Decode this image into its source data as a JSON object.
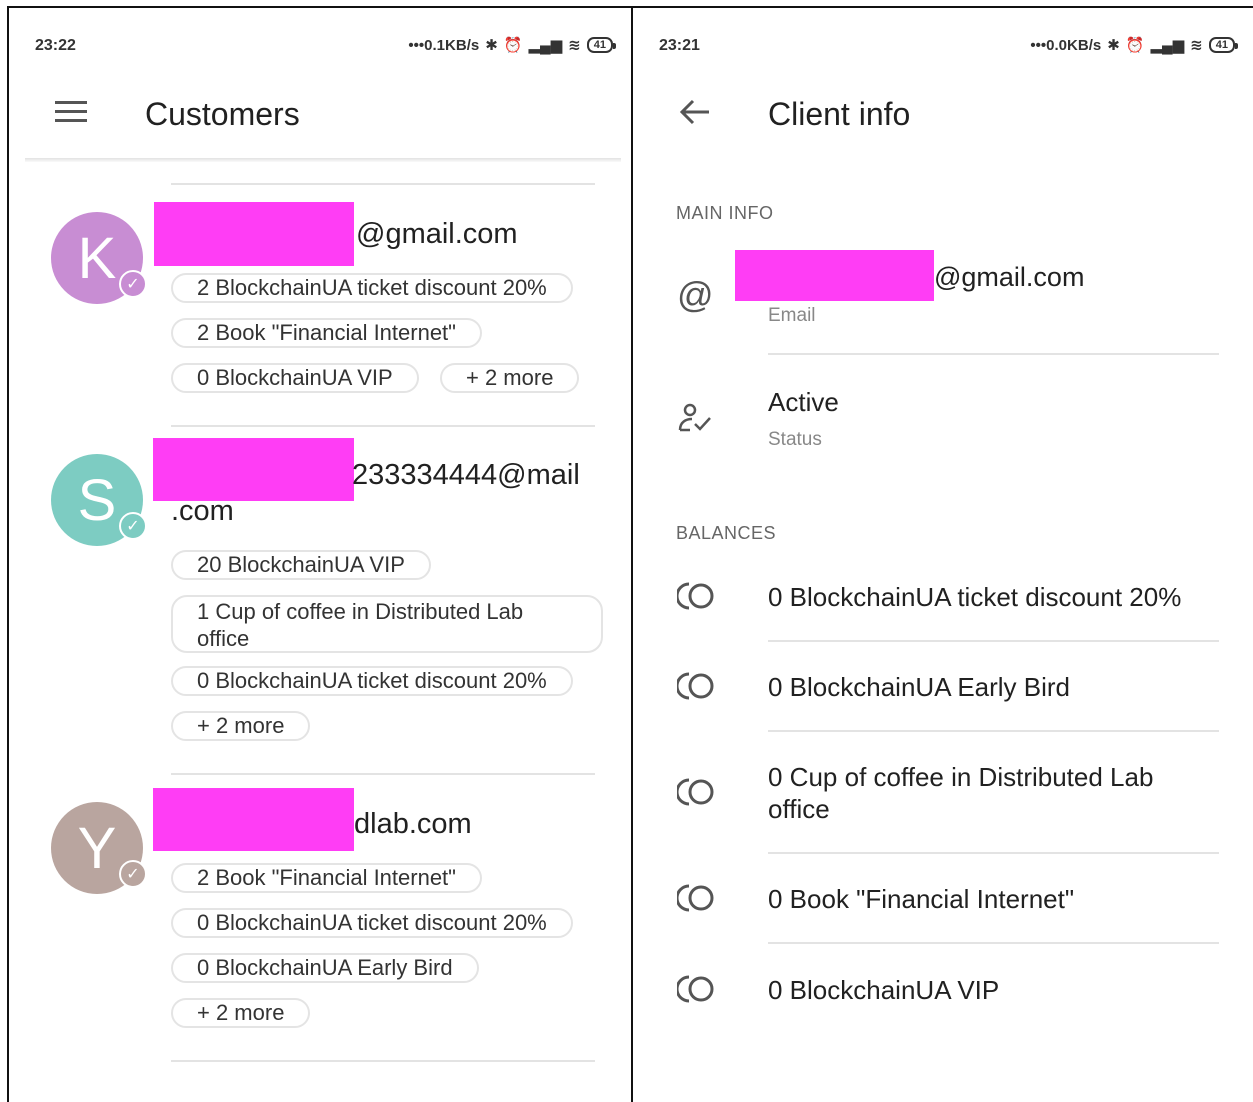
{
  "left_screen": {
    "status": {
      "time": "23:22",
      "network": "•••0.1KB/s",
      "battery": "41"
    },
    "appbar": {
      "title": "Customers"
    },
    "customers": [
      {
        "initial": "K",
        "avatar_color": "#c88dd3",
        "email_suffix": "@gmail.com",
        "chips": [
          "2 BlockchainUA ticket discount 20%",
          "2 Book \"Financial Internet\"",
          "0 BlockchainUA VIP",
          "+ 2 more"
        ]
      },
      {
        "initial": "S",
        "avatar_color": "#7dccc2",
        "email_suffix": "233334444@mail",
        "email_suffix_line2": ".com",
        "chips": [
          "20 BlockchainUA VIP",
          "1 Cup of coffee in Distributed Lab office",
          "0 BlockchainUA ticket discount 20%",
          "+ 2 more"
        ]
      },
      {
        "initial": "Y",
        "avatar_color": "#b9a59f",
        "email_suffix": "dlab.com",
        "chips": [
          "2 Book \"Financial Internet\"",
          "0 BlockchainUA ticket discount 20%",
          "0 BlockchainUA Early Bird",
          "+ 2 more"
        ]
      }
    ]
  },
  "right_screen": {
    "status": {
      "time": "23:21",
      "network": "•••0.0KB/s",
      "battery": "41"
    },
    "appbar": {
      "title": "Client info"
    },
    "main_info": {
      "heading": "MAIN INFO",
      "email_suffix": "@gmail.com",
      "email_label": "Email",
      "status_value": "Active",
      "status_label": "Status"
    },
    "balances": {
      "heading": "BALANCES",
      "items": [
        "0 BlockchainUA ticket discount 20%",
        "0 BlockchainUA Early Bird",
        "0 Cup of coffee in Distributed Lab office",
        "0 Book \"Financial Internet\"",
        "0 BlockchainUA VIP"
      ]
    }
  },
  "colors": {
    "redaction": "#ff3df5",
    "text": "#212121",
    "secondary": "#888888"
  }
}
